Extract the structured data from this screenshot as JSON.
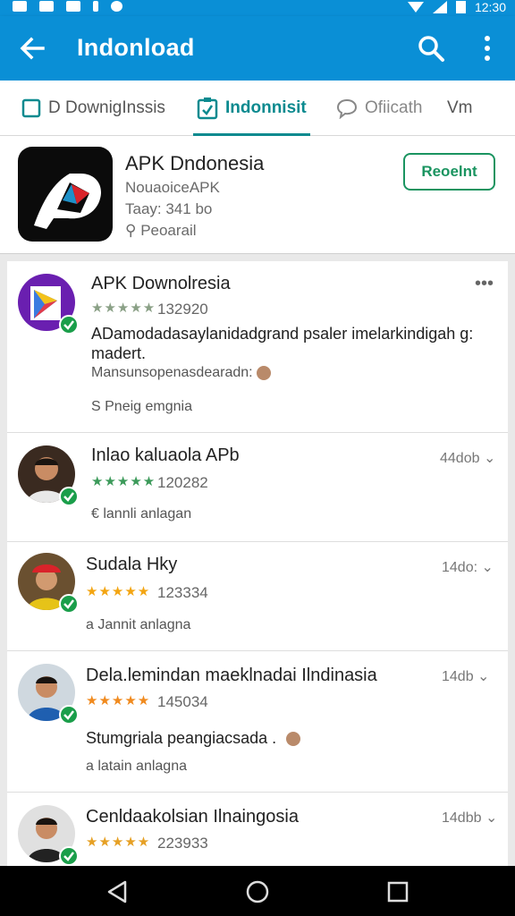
{
  "status_bar": {
    "time": "12:30"
  },
  "app_bar": {
    "title": "Indonload"
  },
  "tabs": [
    {
      "label": "D DownigInssis"
    },
    {
      "label": "Indonnisit"
    },
    {
      "label": "Ofiicath"
    },
    {
      "label": "Vm"
    }
  ],
  "app_header": {
    "name": "APK Dndonesia",
    "developer": "NouaoiceAPK",
    "size": "Taay: 341 bo",
    "rating_text": "Peoarail",
    "reinstall_label": "Reoelnt"
  },
  "reviews": [
    {
      "title": "APK Downolresia",
      "count": "132920",
      "description": "ADamodadasaylanidadgrand psaler imelarkindigah g: madert.",
      "meta": "Mansunsopenasdearadn:",
      "helpful": "S  Pneig emgnia",
      "time": "",
      "star_color": "#8aa086"
    },
    {
      "title": "Inlao kaluaola APb",
      "count": "120282",
      "description": "",
      "meta": "",
      "helpful": "€  lannli anlagan",
      "time": "44dob",
      "star_color": "#3c9a5a"
    },
    {
      "title": "Sudala Hky",
      "count": "123334",
      "description": "",
      "meta": "",
      "helpful": "a  Jannit anlagna",
      "time": "14do:",
      "star_color": "#f3a512"
    },
    {
      "title": "Dela.lemindan maeklnadai Ilndinasia",
      "count": "145034",
      "description": "Stumgriala peangiacsada .",
      "meta": "",
      "helpful": "a  latain anlagna",
      "time": "14db",
      "star_color": "#f08a1e"
    },
    {
      "title": "Cenldaakolsian Ilnaingosia",
      "count": "223933",
      "description": "",
      "meta": "",
      "helpful": "",
      "time": "14dbb",
      "star_color": "#e6a024"
    }
  ]
}
